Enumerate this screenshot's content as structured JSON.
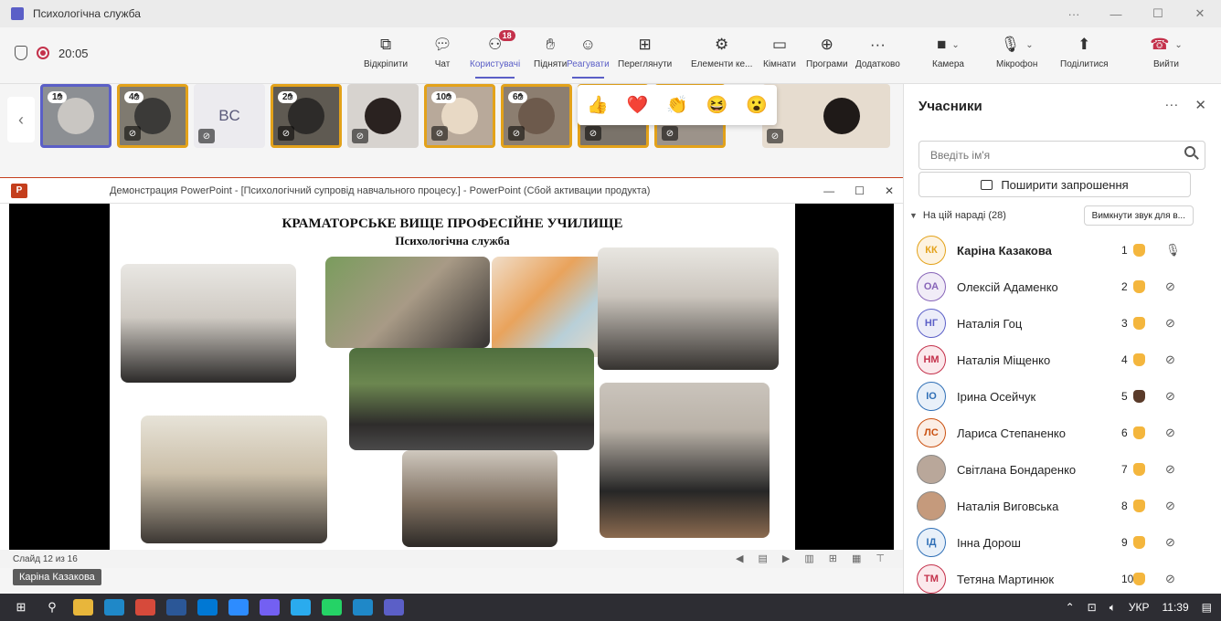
{
  "window": {
    "title": "Психологічна служба",
    "controls": [
      "···",
      "—",
      "☐",
      "✕"
    ]
  },
  "toolbar": {
    "timer": "20:05",
    "buttons": [
      {
        "label": "Відкріпити",
        "icon": "unpin-icon"
      },
      {
        "label": "Чат",
        "icon": "chat-icon"
      },
      {
        "label": "Користувачі",
        "icon": "people-icon",
        "badge": "18"
      },
      {
        "label": "Підняти",
        "icon": "raise-hand-icon"
      },
      {
        "label": "Реагувати",
        "icon": "react-icon"
      },
      {
        "label": "Переглянути",
        "icon": "view-icon"
      },
      {
        "label": "Елементи ке...",
        "icon": "apps-icon"
      },
      {
        "label": "Кімнати",
        "icon": "rooms-icon"
      },
      {
        "label": "Програми",
        "icon": "add-apps-icon"
      },
      {
        "label": "Додатково",
        "icon": "more-icon"
      },
      {
        "label": "Камера",
        "icon": "camera-icon"
      },
      {
        "label": "Мікрофон",
        "icon": "mic-off-icon"
      },
      {
        "label": "Поділитися",
        "icon": "share-icon"
      },
      {
        "label": "Вийти",
        "icon": "leave-call-icon"
      }
    ]
  },
  "video_tiles": [
    {
      "hand": "1"
    },
    {
      "hand": "4"
    },
    {
      "initials": "BC"
    },
    {
      "hand": "2"
    },
    {
      "hand": ""
    },
    {
      "hand": "10"
    },
    {
      "hand": "6"
    },
    {
      "hand": ""
    },
    {
      "hand": ""
    }
  ],
  "reactions": [
    "👍",
    "❤️",
    "👏",
    "😆",
    "😮"
  ],
  "ppt": {
    "title": "Демонстрация PowerPoint - [Психологічний супровід навчального процесу.] - PowerPoint (Сбой активации продукта)",
    "slide_title": "КРАМАТОРСЬКЕ ВИЩЕ ПРОФЕСІЙНЕ УЧИЛИЩЕ",
    "slide_subtitle": "Психологічна служба",
    "slide_number": "Слайд 12 из 16"
  },
  "speaker_label": "Каріна Казакова",
  "panel": {
    "title": "Учасники",
    "search_placeholder": "Введіть ім'я",
    "invite_label": "Поширити запрошення",
    "meeting_label": "На цій нараді (28)",
    "mute_all_label": "Вимкнути звук для в...",
    "participants": [
      {
        "initials": "КК",
        "name": "Каріна Казакова",
        "hand": "1",
        "color": "#e3a21a",
        "bg": "#fdf3e1",
        "mic": "on"
      },
      {
        "initials": "ОА",
        "name": "Олексій Адаменко",
        "hand": "2",
        "color": "#8764b8",
        "bg": "#f1ecf7",
        "mic": "off"
      },
      {
        "initials": "НГ",
        "name": "Наталія Гоц",
        "hand": "3",
        "color": "#5b5fc7",
        "bg": "#ecedf9",
        "mic": "off"
      },
      {
        "initials": "НМ",
        "name": "Наталія Міщенко",
        "hand": "4",
        "color": "#c4314b",
        "bg": "#fbe9ec",
        "mic": "off"
      },
      {
        "initials": "ІО",
        "name": "Ірина Осейчук",
        "hand": "5",
        "color": "#2f6fb6",
        "bg": "#e8f0f9",
        "mic": "off",
        "hand_dark": true
      },
      {
        "initials": "ЛС",
        "name": "Лариса Степаненко",
        "hand": "6",
        "color": "#ca5010",
        "bg": "#fbeee5",
        "mic": "off"
      },
      {
        "initials": "",
        "name": "Світлана Бондаренко",
        "hand": "7",
        "color": "#8a8886",
        "bg": "#b9a79a",
        "mic": "off"
      },
      {
        "initials": "",
        "name": "Наталія Виговська",
        "hand": "8",
        "color": "#8a8886",
        "bg": "#c59a7c",
        "mic": "off"
      },
      {
        "initials": "ІД",
        "name": "Інна Дорош",
        "hand": "9",
        "color": "#2f6fb6",
        "bg": "#e8f0f9",
        "mic": "off"
      },
      {
        "initials": "ТМ",
        "name": "Тетяна Мартинюк",
        "hand": "10",
        "color": "#c4314b",
        "bg": "#fbe9ec",
        "mic": "off"
      }
    ]
  },
  "taskbar": {
    "language": "УКР",
    "time": "11:39"
  }
}
